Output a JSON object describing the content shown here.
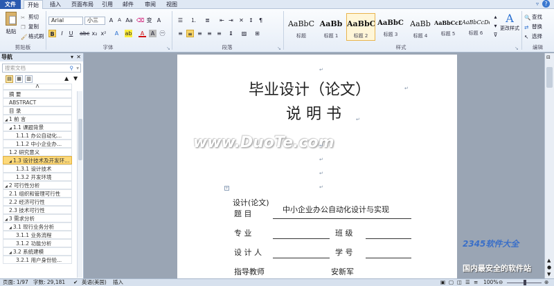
{
  "tabs": [
    "文件",
    "开始",
    "插入",
    "页面布局",
    "引用",
    "邮件",
    "审阅",
    "视图"
  ],
  "clipboard": {
    "paste": "粘贴",
    "cut": "剪切",
    "copy": "复制",
    "format_painter": "格式刷",
    "label": "剪贴板"
  },
  "font": {
    "name": "Arial",
    "size": "小三",
    "label": "字体"
  },
  "paragraph": {
    "label": "段落"
  },
  "styles": {
    "items": [
      {
        "sample": "AaBbC",
        "name": "标题"
      },
      {
        "sample": "AaBb",
        "name": "标题 1"
      },
      {
        "sample": "AaBbC",
        "name": "标题 2"
      },
      {
        "sample": "AaBbC",
        "name": "标题 3"
      },
      {
        "sample": "AaBb",
        "name": "标题 4"
      },
      {
        "sample": "AaBbCcD",
        "name": "标题 5"
      },
      {
        "sample": "AaBbCcDd",
        "name": "标题 6"
      }
    ],
    "change": "更改样式",
    "label": "样式"
  },
  "editing": {
    "find": "查找",
    "replace": "替换",
    "select": "选择",
    "label": "编辑"
  },
  "nav": {
    "title": "导航",
    "search_placeholder": "搜索文档",
    "items": [
      "摘  要",
      "ABSTRACT",
      "目  录",
      "1 前  言",
      "1.1 课题背景",
      "1.1.1 办公自动化...",
      "1.1.2 中小企业办...",
      "1.2 研究意义",
      "1.3 设计技术及开发环...",
      "1.3.1 设计技术",
      "1.3.2 开发环境",
      "2 可行性分析",
      "2.1 组织和管理可行性",
      "2.2 经济可行性",
      "2.3 技术可行性",
      "3 需求分析",
      "3.1 现行业务分析",
      "3.1.1 业务流程",
      "3.1.2 功能分析",
      "3.2 系统建模",
      "3.2.1 用户身份验..."
    ]
  },
  "page": {
    "title1": "毕业设计（论文）",
    "title2": "说  明  书",
    "watermark": "www.DuoTe.com",
    "field_design": "设计(论文)",
    "field_topic": "题        目",
    "topic_value": "中小企业办公自动化设计与实现",
    "field_major": "专        业",
    "field_class": "班    级",
    "field_designer": "设  计  人",
    "field_number": "学    号",
    "field_advisor": "指导教师",
    "advisor_value": "安新军"
  },
  "status": {
    "page": "页面: 1/97",
    "words": "字数: 29,181",
    "lang": "英语(美国)",
    "mode": "插入",
    "zoom": "100%"
  },
  "brand": {
    "logo": "2345软件大全",
    "slogan": "国内最安全的软件站"
  }
}
